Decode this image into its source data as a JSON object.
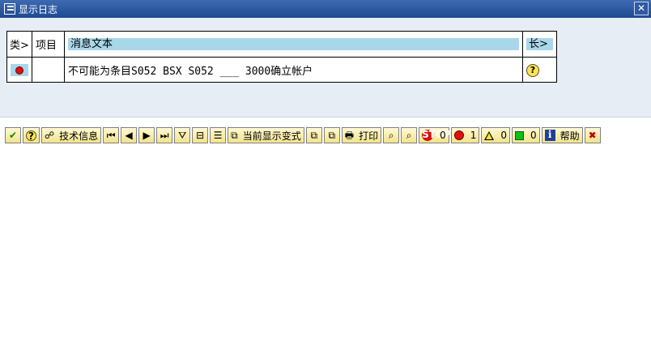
{
  "window": {
    "title": "显示日志",
    "close_glyph": "✕"
  },
  "grid": {
    "headers": {
      "type": "类>",
      "item": "项目",
      "message": "消息文本",
      "long": "长>"
    },
    "rows": [
      {
        "status": "error",
        "item": "",
        "message": "不可能为条目S052 BSX S052 ___ 3000确立帐户",
        "long_text_icon": "help-icon"
      }
    ]
  },
  "toolbar": {
    "tech_info_label": "技术信息",
    "current_layout_label": "当前显示变式",
    "print_label": "打印",
    "stop_count": "0",
    "error_count": "1",
    "warning_count": "0",
    "success_count": "0",
    "help_label": "帮助",
    "glyphs": {
      "check": "✔",
      "question": "?",
      "tech": "☍",
      "first": "⏮",
      "prev": "◀",
      "next": "▶",
      "last": "⏭",
      "filter": "⛛",
      "sum": "⊟",
      "subtotal": "☰",
      "layout": "⧉",
      "copy1": "⧉",
      "copy2": "⧉",
      "print": "🖶",
      "find": "⌕",
      "find_next": "⌕",
      "stop": "STOP",
      "info": "i",
      "cancel": "✖"
    }
  }
}
